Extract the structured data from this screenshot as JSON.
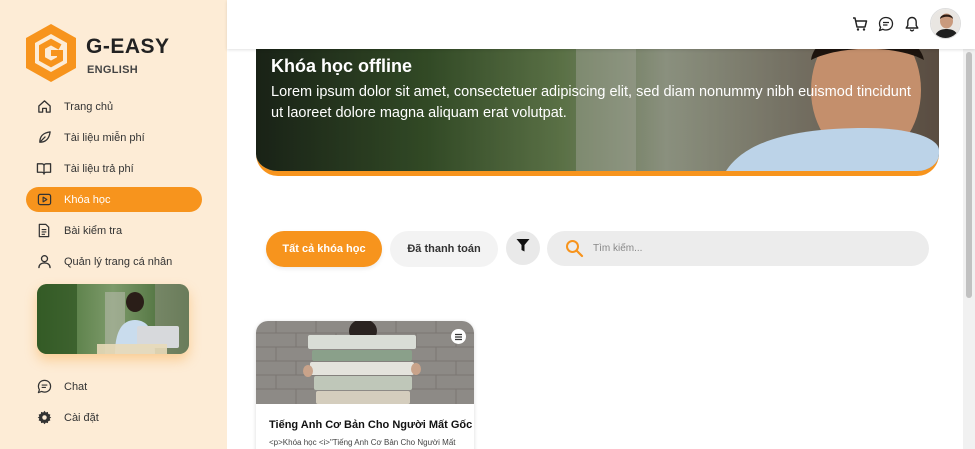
{
  "brand": {
    "name": "G-EASY",
    "sub": "ENGLISH",
    "accent": "#f7941d"
  },
  "sidebar": {
    "items": [
      {
        "label": "Trang chủ",
        "icon": "home-icon"
      },
      {
        "label": "Tài liệu miễn phí",
        "icon": "leaf-icon"
      },
      {
        "label": "Tài liệu trả phí",
        "icon": "book-open-icon"
      },
      {
        "label": "Khóa học",
        "icon": "video-icon",
        "active": true
      },
      {
        "label": "Bài kiểm tra",
        "icon": "document-icon"
      },
      {
        "label": "Quản lý trang cá nhân",
        "icon": "user-icon"
      }
    ],
    "bottom_items": [
      {
        "label": "Chat",
        "icon": "chat-icon"
      },
      {
        "label": "Cài đặt",
        "icon": "gear-icon"
      }
    ]
  },
  "topbar": {
    "icons": [
      "cart-icon",
      "message-icon",
      "bell-icon",
      "avatar"
    ]
  },
  "banner": {
    "title": "Khóa học offline",
    "description": "Lorem ipsum dolor sit amet, consectetuer adipiscing elit, sed diam nonummy nibh euismod tincidunt ut laoreet dolore magna aliquam erat volutpat."
  },
  "filters": {
    "all_label": "Tất cả khóa học",
    "paid_label": "Đã thanh toán",
    "search_placeholder": "Tìm kiếm..."
  },
  "courses": [
    {
      "title": "Tiếng Anh Cơ Bản Cho Người Mất Gốc",
      "desc": "<p>Khóa học <i>\"Tiếng Anh Cơ Bản Cho Người Mất"
    }
  ]
}
